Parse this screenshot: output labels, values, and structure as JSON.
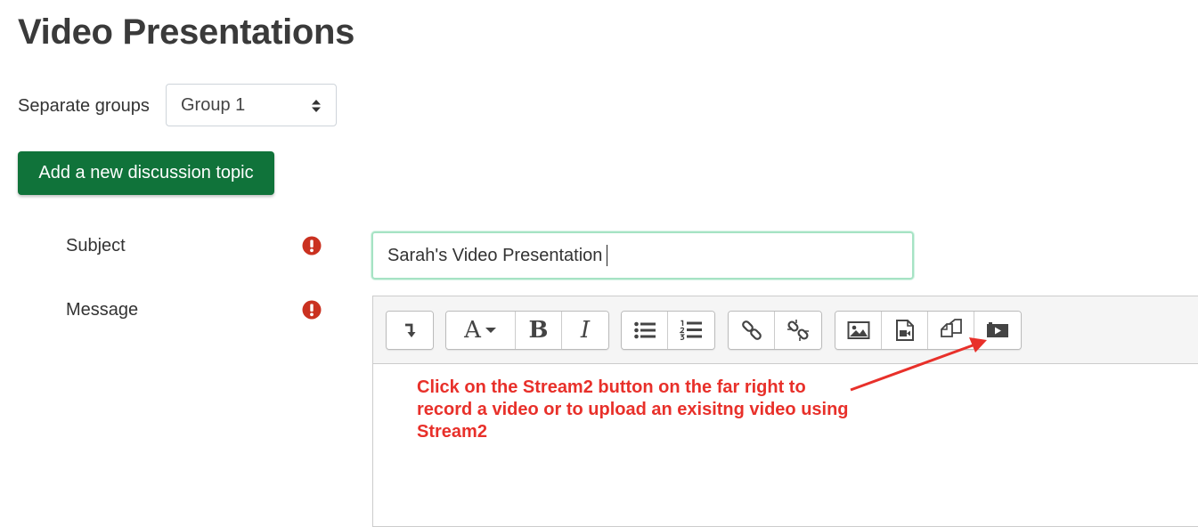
{
  "page": {
    "title": "Video Presentations"
  },
  "groups": {
    "label": "Separate groups",
    "selected": "Group 1"
  },
  "actions": {
    "add_topic_label": "Add a new discussion topic"
  },
  "form": {
    "subject": {
      "label": "Subject",
      "value": "Sarah's Video Presentation"
    },
    "message": {
      "label": "Message"
    }
  },
  "toolbar": {
    "groups": [
      {
        "buttons": [
          "show-more-icon"
        ]
      },
      {
        "buttons": [
          "font-style-icon",
          "bold-icon",
          "italic-icon"
        ]
      },
      {
        "buttons": [
          "unordered-list-icon",
          "ordered-list-icon"
        ]
      },
      {
        "buttons": [
          "link-icon",
          "unlink-icon"
        ]
      },
      {
        "buttons": [
          "image-icon",
          "media-icon",
          "manage-files-icon",
          "stream2-icon"
        ]
      }
    ]
  },
  "annotation": {
    "text": "Click on the Stream2 button on the far right to record a video or to upload an exisitng video using Stream2",
    "color": "#e8302a"
  },
  "colors": {
    "primary_button": "#10733a",
    "required_icon": "#ca3120",
    "input_focus": "#a6e3c4"
  }
}
